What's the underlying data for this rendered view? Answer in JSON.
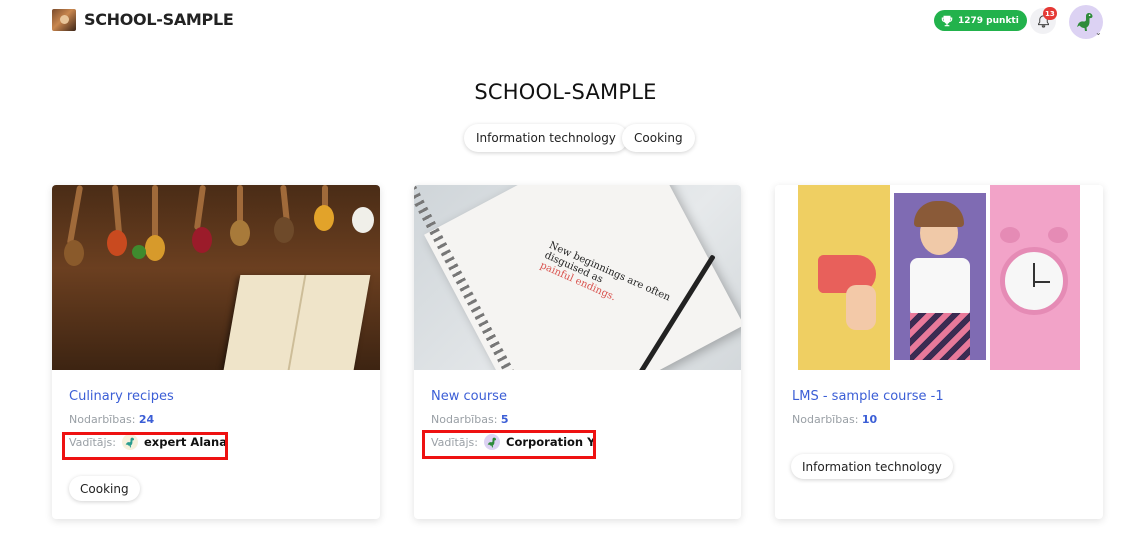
{
  "header": {
    "brand": "SCHOOL-SAMPLE",
    "points_label": "1279 punkti",
    "notifications_count": "13"
  },
  "page": {
    "title": "SCHOOL-SAMPLE",
    "categories": [
      "Information technology",
      "Cooking"
    ]
  },
  "courses": [
    {
      "title": "Culinary recipes",
      "activities_label": "Nodarbības:",
      "activities_count": "24",
      "leader_label": "Vadītājs:",
      "leader_name": "expert Alana",
      "tag": "Cooking"
    },
    {
      "title": "New course",
      "activities_label": "Nodarbības:",
      "activities_count": "5",
      "leader_label": "Vadītājs:",
      "leader_name": "Corporation Y",
      "notebook_line1": "New beginnings are often",
      "notebook_line2": "disguised as",
      "notebook_line3": "painful endings."
    },
    {
      "title": "LMS - sample course -1",
      "activities_label": "Nodarbības:",
      "activities_count": "10",
      "tag": "Information technology"
    }
  ],
  "colors": {
    "accent": "#3b5ed6",
    "points": "#22b24c",
    "badge": "#e53935",
    "highlight": "#ee1111"
  }
}
